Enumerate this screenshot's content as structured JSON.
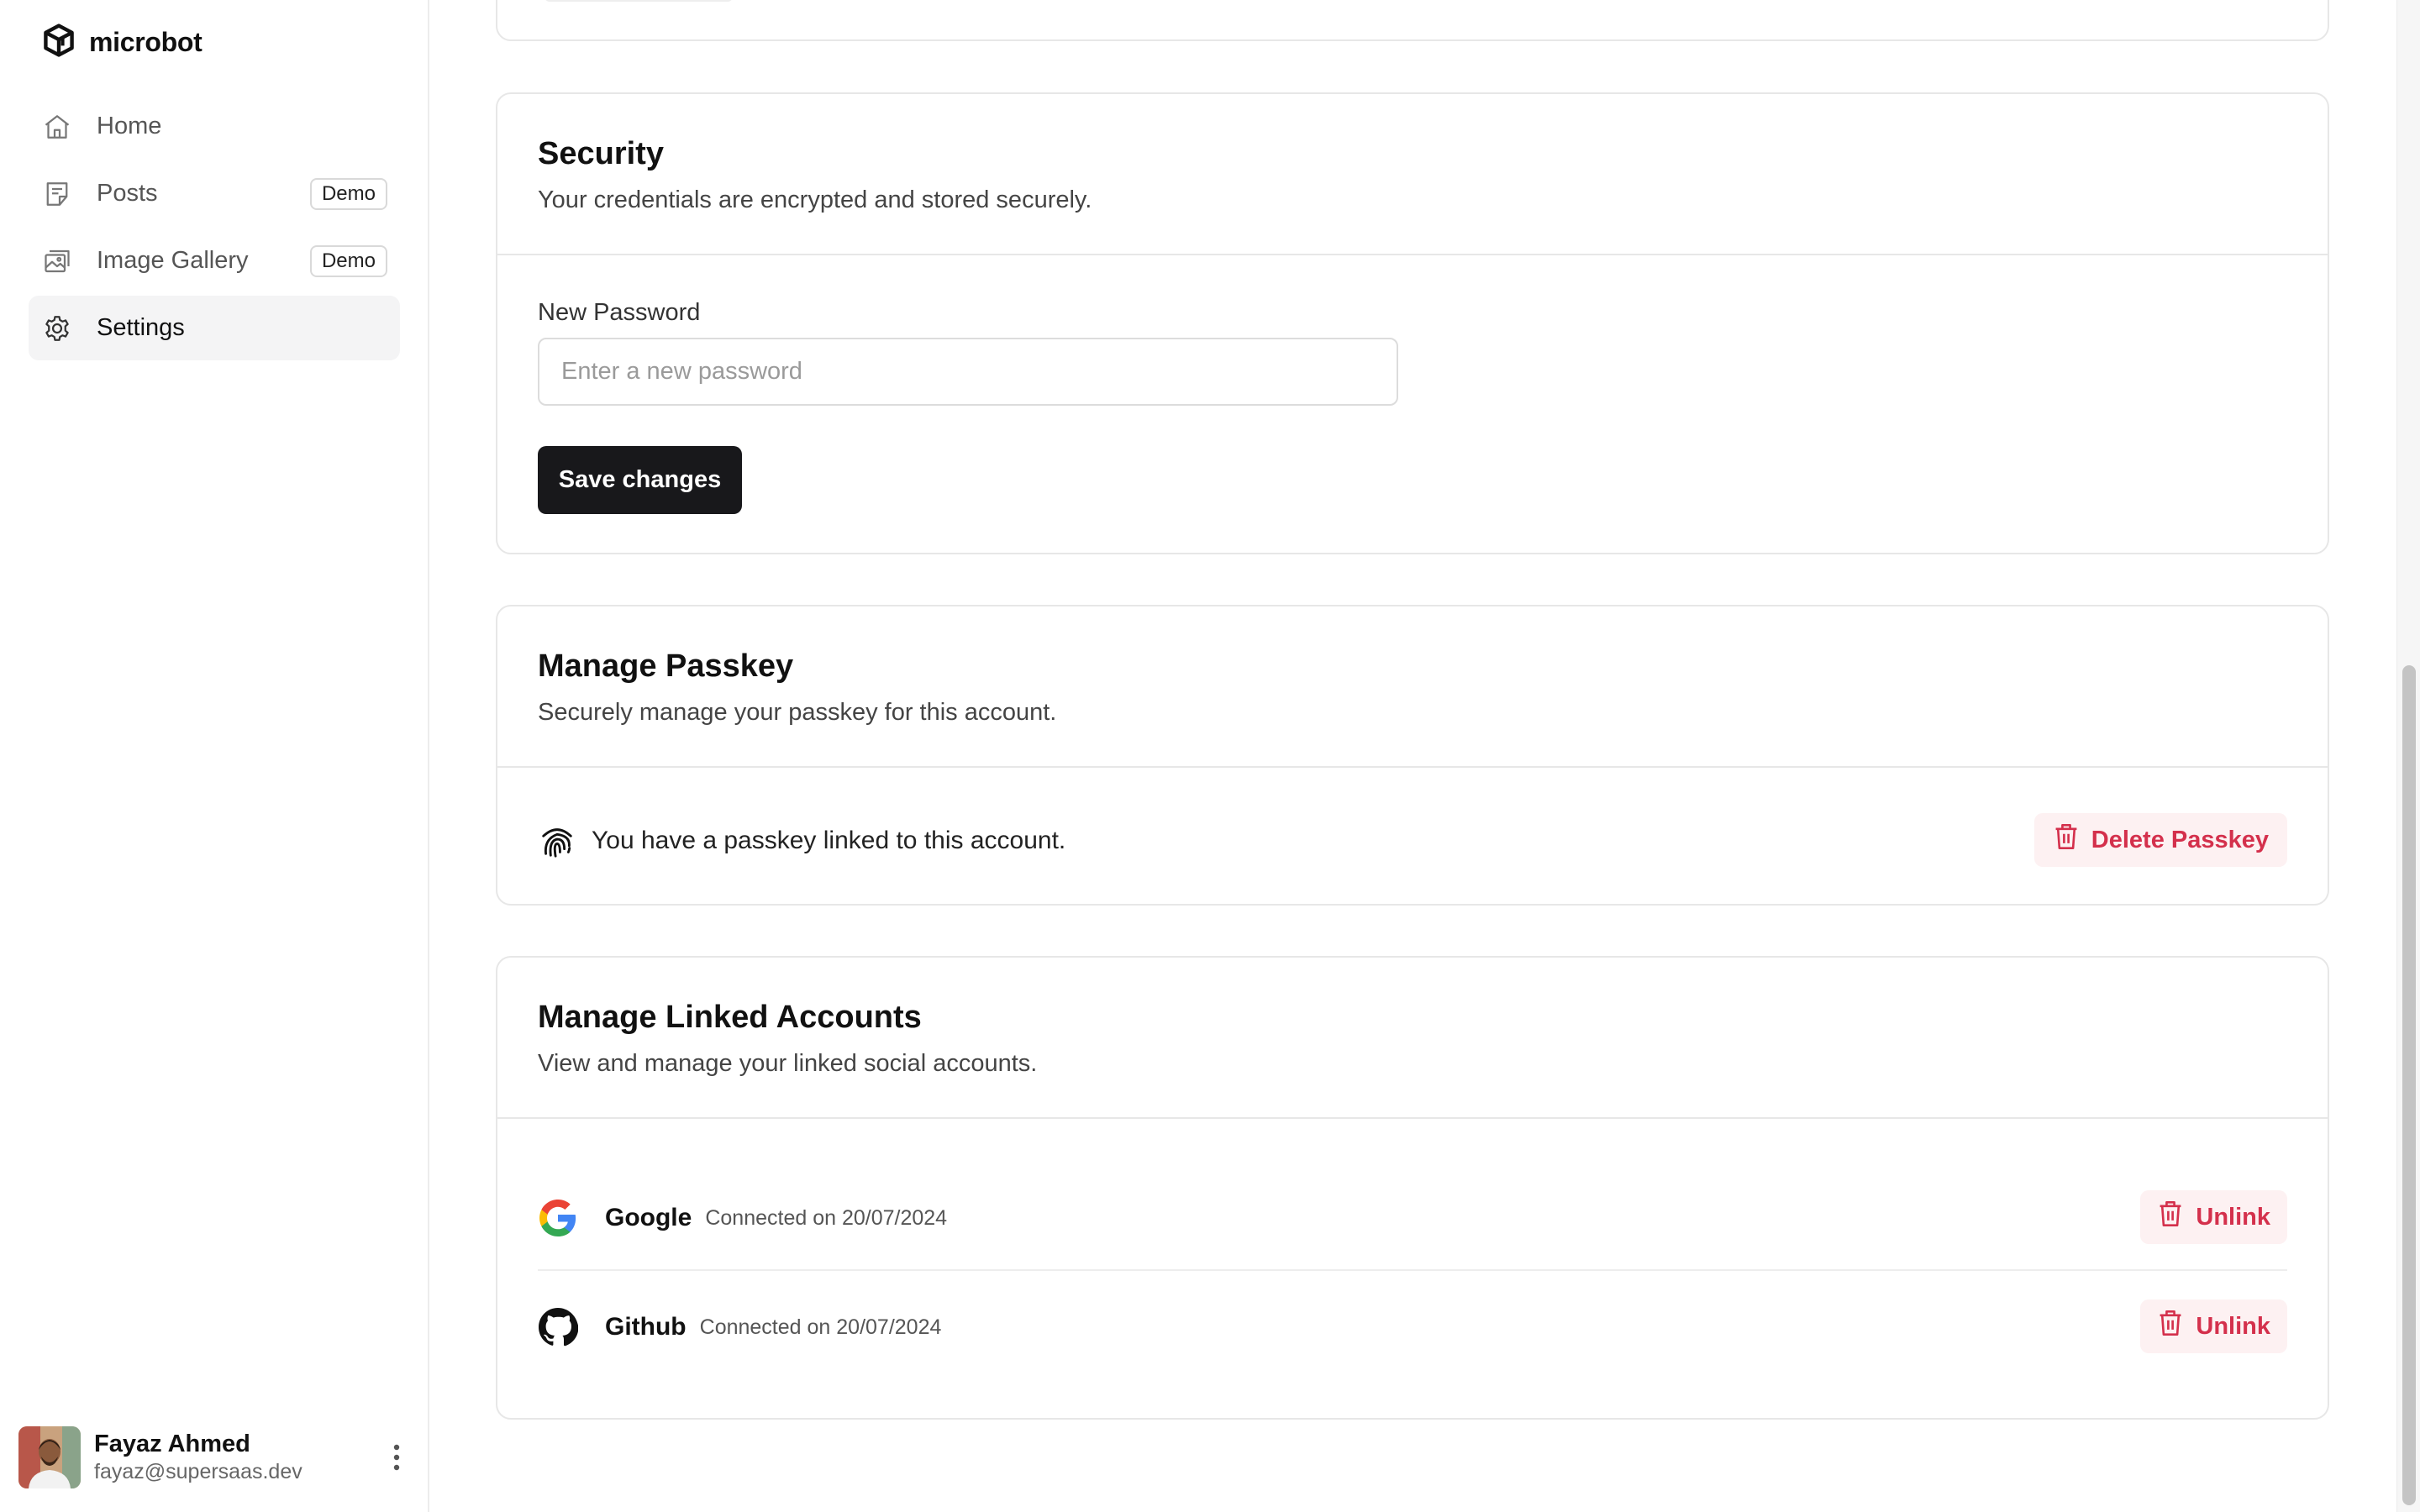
{
  "app": {
    "name": "microbot"
  },
  "sidebar": {
    "items": [
      {
        "label": "Home",
        "icon": "home-icon",
        "active": false
      },
      {
        "label": "Posts",
        "icon": "posts-icon",
        "badge": "Demo",
        "active": false
      },
      {
        "label": "Image Gallery",
        "icon": "image-gallery-icon",
        "badge": "Demo",
        "active": false
      },
      {
        "label": "Settings",
        "icon": "gear-icon",
        "active": true
      }
    ]
  },
  "user": {
    "name": "Fayaz Ahmed",
    "email": "fayaz@supersaas.dev"
  },
  "security": {
    "title": "Security",
    "description": "Your credentials are encrypted and stored securely.",
    "password_label": "New Password",
    "password_placeholder": "Enter a new password",
    "password_value": "",
    "save_label": "Save changes"
  },
  "passkey": {
    "title": "Manage Passkey",
    "description": "Securely manage your passkey for this account.",
    "status_text": "You have a passkey linked to this account.",
    "delete_label": "Delete Passkey"
  },
  "linked_accounts": {
    "title": "Manage Linked Accounts",
    "description": "View and manage your linked social accounts.",
    "accounts": [
      {
        "provider": "Google",
        "connected": "Connected on 20/07/2024",
        "action": "Unlink",
        "icon": "google-icon"
      },
      {
        "provider": "Github",
        "connected": "Connected on 20/07/2024",
        "action": "Unlink",
        "icon": "github-icon"
      }
    ]
  },
  "colors": {
    "danger": "#d4304c",
    "danger_bg": "#fdf1f2",
    "primary_button": "#18181b",
    "active_nav_bg": "#f4f4f5"
  }
}
